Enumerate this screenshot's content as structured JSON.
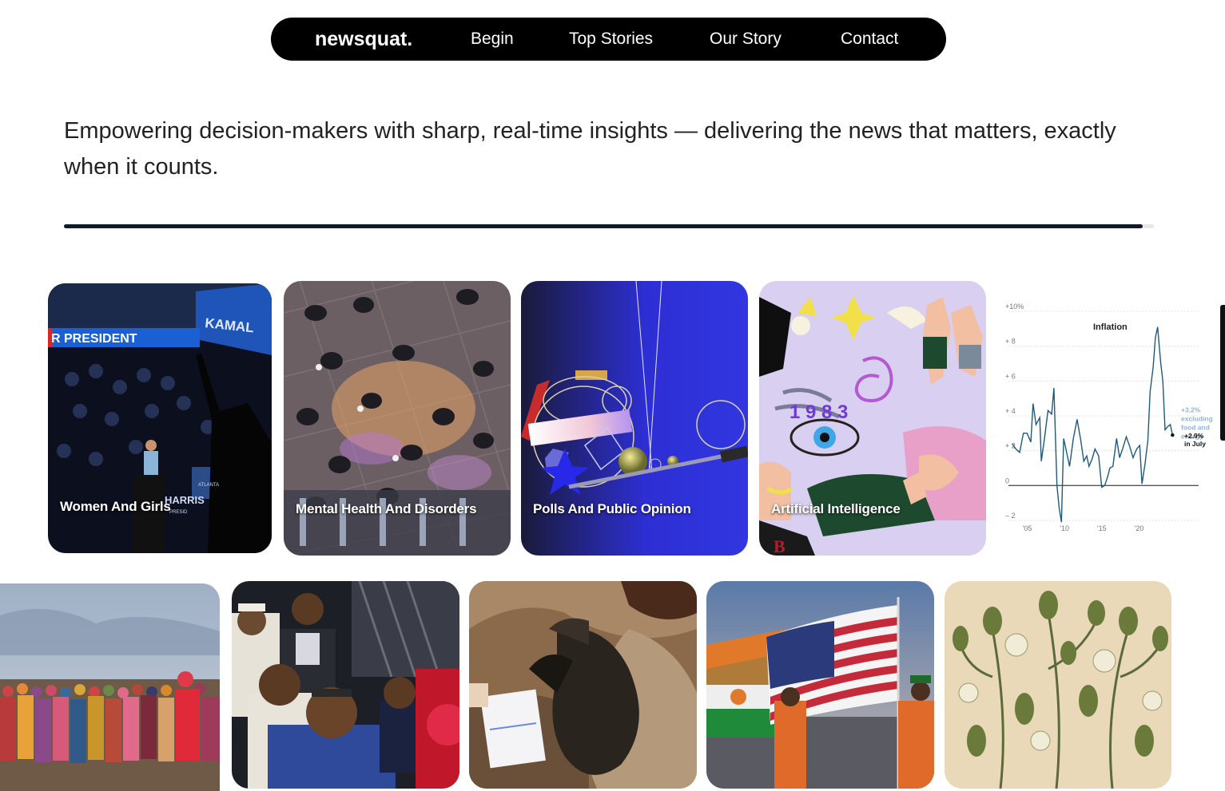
{
  "nav": {
    "brand": "newsquat.",
    "links": [
      "Begin",
      "Top Stories",
      "Our Story",
      "Contact"
    ]
  },
  "tagline": "Empowering decision-makers with sharp, real-time insights — delivering the news that matters, exactly when it counts.",
  "progress": {
    "fraction": 0.99
  },
  "cards_row1": [
    {
      "label": "Women And Girls",
      "photo_text": [
        "R PRESIDENT",
        "KAMAL",
        "ATLANTA",
        "HARRIS",
        "PRESID"
      ]
    },
    {
      "label": "Mental Health And Disorders"
    },
    {
      "label": "Polls And Public Opinion"
    },
    {
      "label": "Artificial Intelligence",
      "photo_text": [
        "1 9 8 3",
        "B"
      ]
    }
  ],
  "inflation_chart": {
    "title": "Inflation",
    "y_ticks": [
      "+10%",
      "+ 8",
      "+ 6",
      "+ 4",
      "+ 2",
      "0",
      "– 2"
    ],
    "x_ticks": [
      "’05",
      "’10",
      "’15",
      "’20"
    ],
    "annotation_core": [
      "+3.2%",
      "excluding",
      "food and",
      "energy"
    ],
    "annotation_headline": [
      "+2.9%",
      "in July"
    ]
  },
  "chart_data": {
    "type": "line",
    "title": "Inflation",
    "xlabel": "",
    "ylabel": "",
    "ylim": [
      -2,
      10
    ],
    "x_ticks": [
      2005,
      2010,
      2015,
      2020
    ],
    "series": [
      {
        "values": [
          [
            2003.0,
            2.4
          ],
          [
            2003.5,
            2.1
          ],
          [
            2004.0,
            1.9
          ],
          [
            2004.5,
            3.0
          ],
          [
            2005.0,
            3.0
          ],
          [
            2005.5,
            2.5
          ],
          [
            2005.8,
            4.7
          ],
          [
            2006.2,
            3.5
          ],
          [
            2006.7,
            3.9
          ],
          [
            2006.9,
            1.4
          ],
          [
            2007.3,
            2.6
          ],
          [
            2007.8,
            4.3
          ],
          [
            2008.3,
            4.1
          ],
          [
            2008.6,
            5.6
          ],
          [
            2009.0,
            0.0
          ],
          [
            2009.3,
            -1.3
          ],
          [
            2009.6,
            -2.1
          ],
          [
            2009.9,
            2.7
          ],
          [
            2010.2,
            2.1
          ],
          [
            2010.7,
            1.1
          ],
          [
            2011.2,
            2.7
          ],
          [
            2011.7,
            3.8
          ],
          [
            2012.2,
            2.6
          ],
          [
            2012.6,
            1.4
          ],
          [
            2013.0,
            1.7
          ],
          [
            2013.3,
            1.1
          ],
          [
            2013.7,
            1.5
          ],
          [
            2014.1,
            2.1
          ],
          [
            2014.6,
            1.7
          ],
          [
            2015.0,
            -0.1
          ],
          [
            2015.4,
            0.0
          ],
          [
            2015.8,
            0.5
          ],
          [
            2016.1,
            1.0
          ],
          [
            2016.5,
            1.1
          ],
          [
            2017.0,
            2.7
          ],
          [
            2017.4,
            1.6
          ],
          [
            2017.8,
            2.1
          ],
          [
            2018.3,
            2.8
          ],
          [
            2018.8,
            2.2
          ],
          [
            2019.2,
            1.6
          ],
          [
            2019.7,
            2.1
          ],
          [
            2020.1,
            2.3
          ],
          [
            2020.4,
            0.1
          ],
          [
            2020.8,
            1.2
          ],
          [
            2021.2,
            2.6
          ],
          [
            2021.5,
            5.4
          ],
          [
            2021.9,
            6.8
          ],
          [
            2022.2,
            8.5
          ],
          [
            2022.5,
            9.1
          ],
          [
            2022.9,
            7.1
          ],
          [
            2023.2,
            6.0
          ],
          [
            2023.5,
            3.2
          ],
          [
            2023.9,
            3.4
          ],
          [
            2024.2,
            3.5
          ],
          [
            2024.5,
            2.9
          ]
        ]
      }
    ],
    "annotations": [
      "+3.2% excluding food and energy",
      "+2.9% in July"
    ]
  },
  "cards_row2": [
    {
      "name": "crowd-photo"
    },
    {
      "name": "officials-photo"
    },
    {
      "name": "animal-photo"
    },
    {
      "name": "flags-photo"
    },
    {
      "name": "botanical-illustration"
    }
  ]
}
